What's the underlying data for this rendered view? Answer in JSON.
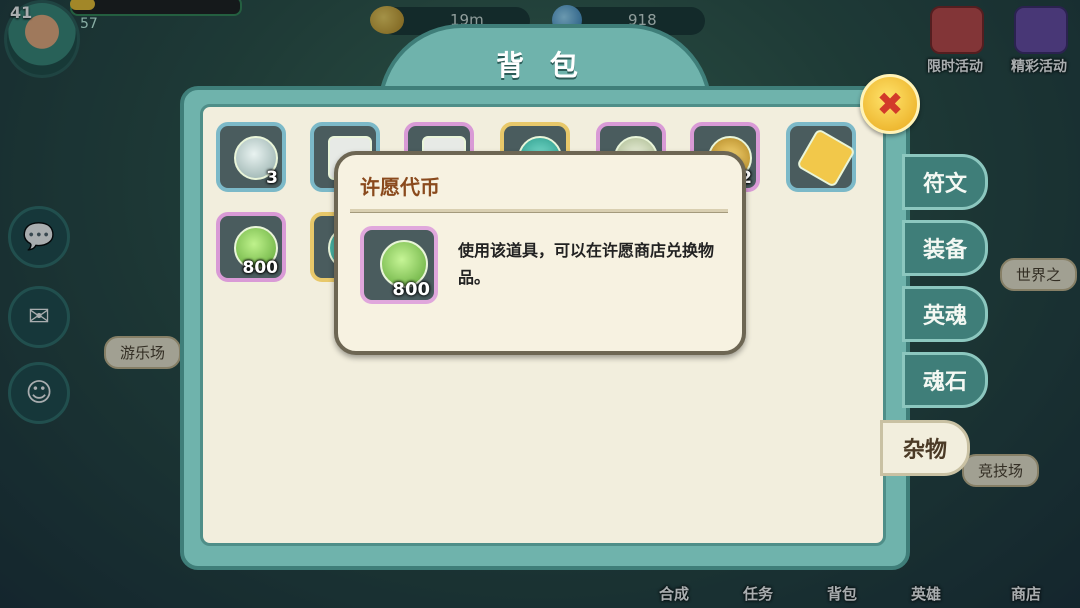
{
  "hud": {
    "level": "41",
    "sub": "57",
    "exp_fill": 0.15,
    "coins": "19m",
    "gems": "918"
  },
  "right_buttons": [
    "限时活动",
    "精彩活动"
  ],
  "bottom_buttons": [
    "合成",
    "任务",
    "背包",
    "英雄",
    "商店"
  ],
  "background_labels": [
    "游乐场",
    "竞技场",
    "世界之"
  ],
  "dialog": {
    "title": "背 包",
    "close_icon": "close-x-icon"
  },
  "items": [
    {
      "count": "3",
      "frame": "blue",
      "icon": "clover-plate-icon"
    },
    {
      "count": "",
      "frame": "blue",
      "icon": "scroll-icon"
    },
    {
      "count": "",
      "frame": "pink",
      "icon": "scroll-icon"
    },
    {
      "count": "",
      "frame": "gold",
      "icon": "gem-icon"
    },
    {
      "count": "",
      "frame": "pink",
      "icon": "plate-icon"
    },
    {
      "count": "2",
      "frame": "pink",
      "icon": "gold-token-icon"
    },
    {
      "count": "",
      "frame": "blue",
      "icon": "ticket-icon"
    },
    {
      "count": "800",
      "frame": "pink",
      "icon": "wish-token-icon"
    },
    {
      "count": "",
      "frame": "gold",
      "icon": "gem-icon"
    }
  ],
  "tabs": [
    "符文",
    "装备",
    "英魂",
    "魂石",
    "杂物"
  ],
  "active_tab": "杂物",
  "tooltip": {
    "title": "许愿代币",
    "count": "800",
    "description": "使用该道具，可以在许愿商店兑换物品。"
  }
}
